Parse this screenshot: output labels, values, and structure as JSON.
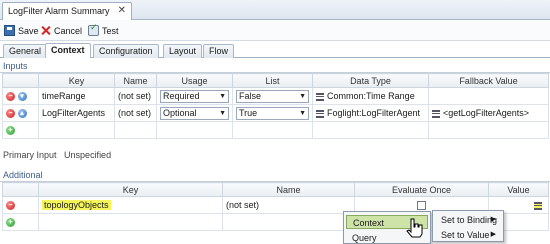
{
  "document_tab": {
    "title": "LogFilter Alarm Summary",
    "close": "✕"
  },
  "toolbar": {
    "save": "Save",
    "cancel": "Cancel",
    "test": "Test"
  },
  "tabs": [
    "General",
    "Context",
    "Configuration",
    "Layout",
    "Flow"
  ],
  "active_tab": "Context",
  "inputs": {
    "label": "Inputs",
    "columns": [
      "Key",
      "Name",
      "Usage",
      "List",
      "Data Type",
      "Fallback Value"
    ],
    "rows": [
      {
        "key": "timeRange",
        "name": "(not set)",
        "usage": "Required",
        "list": "False",
        "data_type": "Common:Time Range",
        "fallback": ""
      },
      {
        "key": "LogFilterAgents",
        "name": "(not set)",
        "usage": "Optional",
        "list": "True",
        "data_type": "Foglight:LogFilterAgent",
        "fallback": "<getLogFilterAgents>"
      }
    ]
  },
  "primary_input": {
    "label": "Primary Input",
    "value": "Unspecified"
  },
  "additional": {
    "label": "Additional",
    "columns": [
      "Key",
      "Name",
      "Evaluate Once",
      "Value"
    ],
    "rows": [
      {
        "key": "topologyObjects",
        "name": "(not set)"
      }
    ]
  },
  "context_menu": {
    "items": [
      "Context",
      "Query"
    ]
  },
  "submenu": {
    "items": [
      "Set to Binding",
      "Set to Value"
    ]
  },
  "colors": {
    "highlight": "#f5f55a",
    "menu_selected": "#cde3a8",
    "accent": "#3b5d88"
  }
}
